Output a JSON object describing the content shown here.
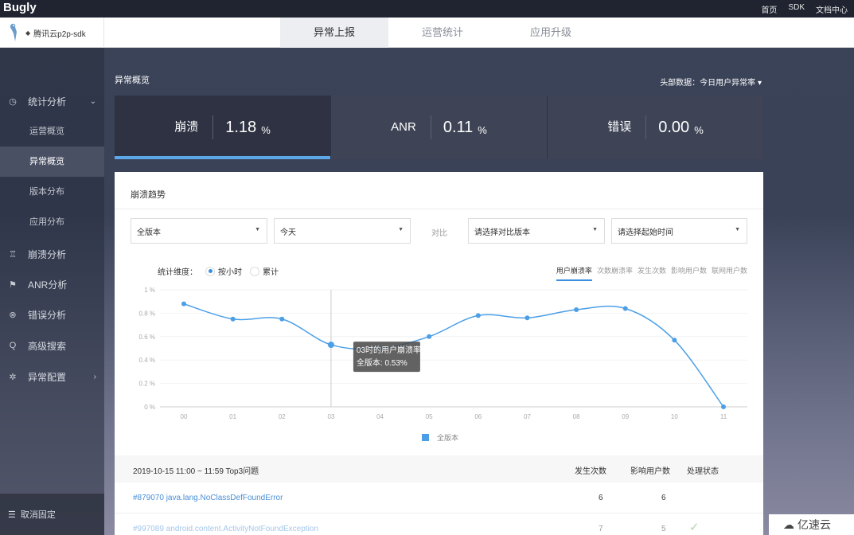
{
  "topbar": {
    "brand": "Bugly",
    "links": [
      "首页",
      "SDK",
      "文档中心"
    ]
  },
  "app": {
    "name": "腾讯云p2p-sdk",
    "tabs": [
      {
        "label": "异常上报",
        "active": true
      },
      {
        "label": "运营统计",
        "active": false
      },
      {
        "label": "应用升级",
        "active": false
      }
    ]
  },
  "sidebar": {
    "stats_group": {
      "label": "统计分析",
      "icon": "clock-icon"
    },
    "sub_items": [
      {
        "label": "运营概览",
        "active": false
      },
      {
        "label": "异常概览",
        "active": true
      },
      {
        "label": "版本分布",
        "active": false
      },
      {
        "label": "应用分布",
        "active": false
      }
    ],
    "items": [
      {
        "label": "崩溃分析",
        "icon": "crash-icon"
      },
      {
        "label": "ANR分析",
        "icon": "anr-icon"
      },
      {
        "label": "错误分析",
        "icon": "error-icon"
      },
      {
        "label": "高级搜索",
        "icon": "search-icon"
      },
      {
        "label": "异常配置",
        "icon": "gear-icon"
      }
    ],
    "unpin": "取消固定"
  },
  "overview": {
    "title": "异常概览",
    "header_select": "头部数据：今日用户异常率",
    "stats": [
      {
        "label": "崩溃",
        "value": "1.18",
        "unit": "%",
        "active": true
      },
      {
        "label": "ANR",
        "value": "0.11",
        "unit": "%",
        "active": false
      },
      {
        "label": "错误",
        "value": "0.00",
        "unit": "%",
        "active": false
      }
    ]
  },
  "trend": {
    "title": "崩溃趋势",
    "filters": {
      "version": "全版本",
      "date": "今天",
      "compare_label": "对比",
      "compare_version": "请选择对比版本",
      "start_time": "请选择起始时间"
    },
    "dimension": {
      "label": "统计维度：",
      "options": [
        {
          "label": "按小时",
          "selected": true
        },
        {
          "label": "累计",
          "selected": false
        }
      ]
    },
    "metrics": [
      {
        "label": "用户崩溃率",
        "active": true
      },
      {
        "label": "次数崩溃率",
        "active": false
      },
      {
        "label": "发生次数",
        "active": false
      },
      {
        "label": "影响用户数",
        "active": false
      },
      {
        "label": "联网用户数",
        "active": false
      }
    ],
    "tooltip": {
      "title": "03时的用户崩溃率",
      "series": "全版本:",
      "value": "0.53%"
    }
  },
  "chart_data": {
    "type": "line",
    "x": [
      "00",
      "01",
      "02",
      "03",
      "04",
      "05",
      "06",
      "07",
      "08",
      "09",
      "10",
      "11"
    ],
    "series": [
      {
        "name": "全版本",
        "values": [
          0.88,
          0.75,
          0.75,
          0.53,
          0.5,
          0.6,
          0.78,
          0.76,
          0.83,
          0.84,
          0.57,
          0.0
        ]
      }
    ],
    "yticks": [
      "0 %",
      "0.2 %",
      "0.4 %",
      "0.6 %",
      "0.8 %",
      "1 %"
    ],
    "ylim": [
      0,
      1
    ],
    "legend": "bottom-center",
    "color": "#4c9fe6"
  },
  "top_issues": {
    "heading": "2019-10-15 11:00 ~ 11:59 Top3问题",
    "cols": [
      "发生次数",
      "影响用户数",
      "处理状态"
    ],
    "rows": [
      {
        "name": "#879070 java.lang.NoClassDefFoundError",
        "count": "6",
        "users": "6"
      },
      {
        "name": "#997089 android.content.ActivityNotFoundException",
        "count": "7",
        "users": "5"
      }
    ]
  },
  "watermark": "亿速云"
}
